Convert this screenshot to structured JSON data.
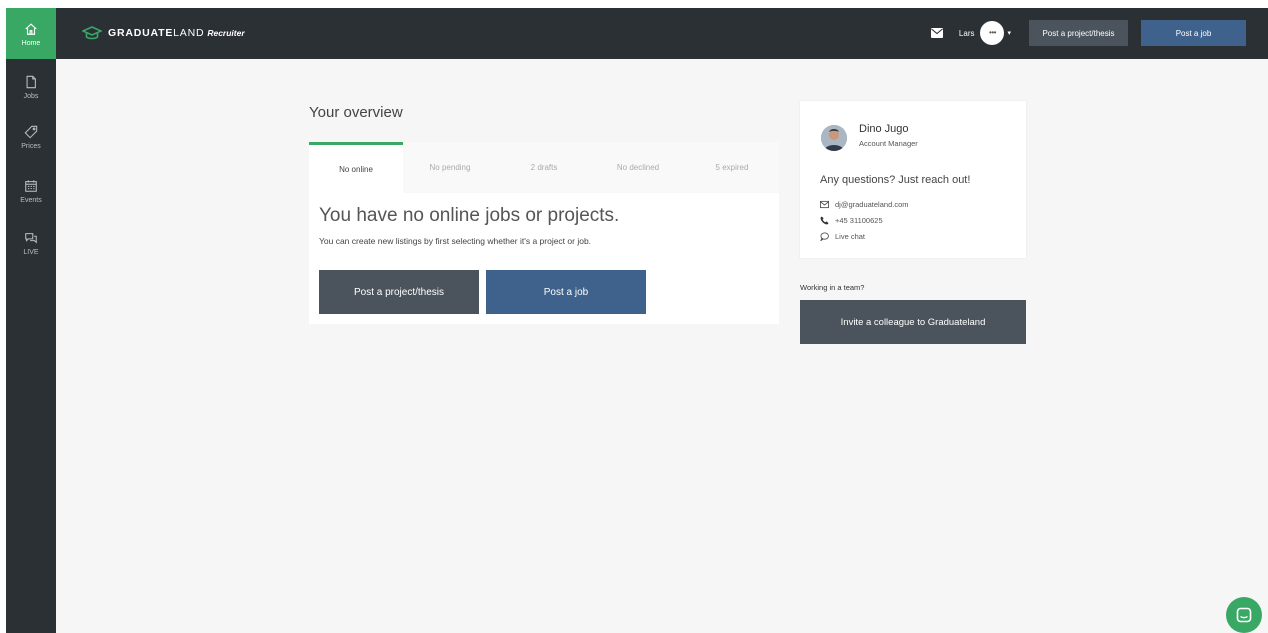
{
  "sidebar": {
    "items": [
      {
        "label": "Home",
        "icon": "home-icon"
      },
      {
        "label": "Jobs",
        "icon": "document-icon"
      },
      {
        "label": "Prices",
        "icon": "tag-icon"
      },
      {
        "label": "Events",
        "icon": "calendar-icon"
      },
      {
        "label": "LIVE",
        "icon": "chat-bubbles-icon"
      }
    ]
  },
  "header": {
    "logo_main_bold": "GRADUATE",
    "logo_main_light": "LAND",
    "logo_sub": "Recruiter",
    "user_name": "Lars",
    "avatar_text": "•••",
    "caret": "▾",
    "post_project_label": "Post a project/thesis",
    "post_job_label": "Post a job"
  },
  "overview": {
    "title": "Your overview",
    "tabs": [
      {
        "label": "No online"
      },
      {
        "label": "No pending"
      },
      {
        "label": "2 drafts"
      },
      {
        "label": "No declined"
      },
      {
        "label": "5 expired"
      }
    ],
    "heading": "You have no online jobs or projects.",
    "subtext": "You can create new listings by first selecting whether it's a project or job.",
    "post_project_label": "Post a project/thesis",
    "post_job_label": "Post a job"
  },
  "contact": {
    "name": "Dino Jugo",
    "role": "Account Manager",
    "question": "Any questions? Just reach out!",
    "email": "dj@graduateland.com",
    "phone": "+45 31100625",
    "chat": "Live chat"
  },
  "team": {
    "label": "Working in a team?",
    "invite_label": "Invite a colleague to Graduateland"
  },
  "colors": {
    "brand_green": "#3aa865",
    "dark_bar": "#2b3035",
    "button_gray": "#4b545c",
    "button_blue": "#3f628d"
  }
}
